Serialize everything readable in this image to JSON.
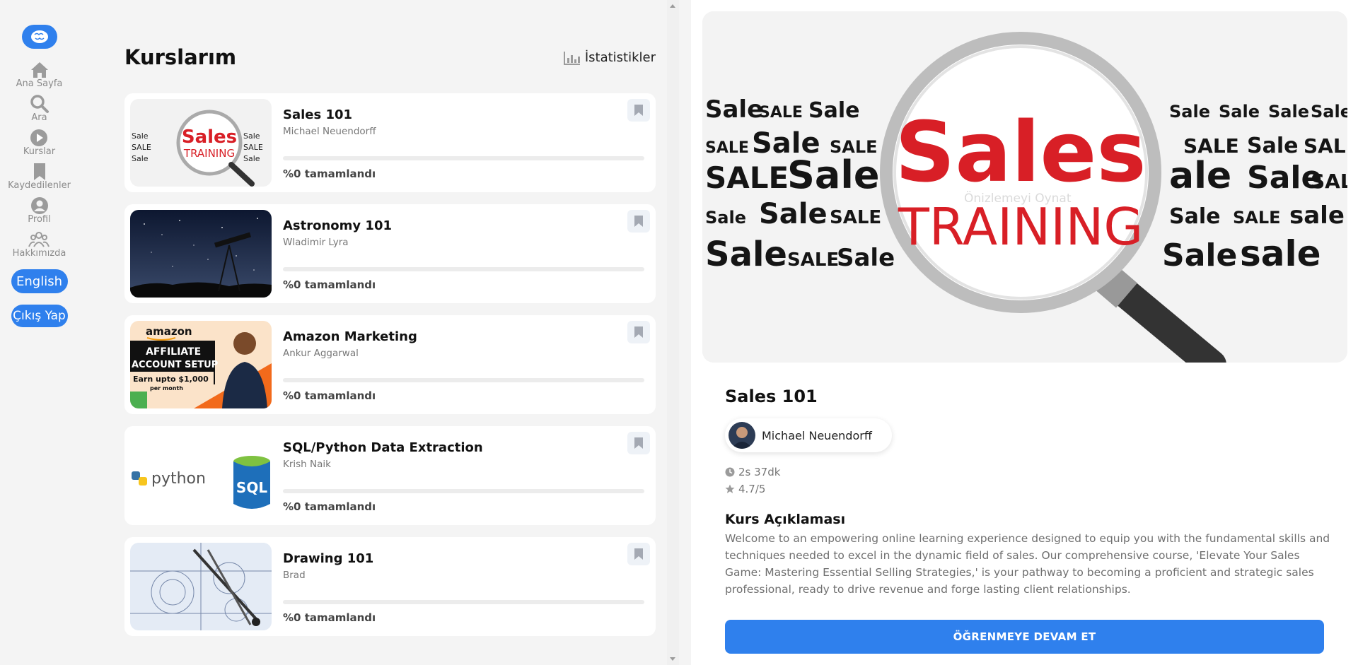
{
  "sidebar": {
    "items": [
      {
        "label": "Ana Sayfa",
        "icon": "home-icon"
      },
      {
        "label": "Ara",
        "icon": "search-icon"
      },
      {
        "label": "Kurslar",
        "icon": "play-icon"
      },
      {
        "label": "Kaydedilenler",
        "icon": "bookmark-icon"
      },
      {
        "label": "Profil",
        "icon": "user-icon"
      },
      {
        "label": "Hakkımızda",
        "icon": "group-icon"
      }
    ],
    "language_label": "English",
    "logout_label": "Çıkış Yap"
  },
  "list": {
    "title": "Kurslarım",
    "stats_label": "İstatistikler",
    "courses": [
      {
        "title": "Sales 101",
        "author": "Michael Neuendorff",
        "progress_text": "%0 tamamlandı",
        "progress": 0
      },
      {
        "title": "Astronomy 101",
        "author": "Wladimir Lyra",
        "progress_text": "%0 tamamlandı",
        "progress": 0
      },
      {
        "title": "Amazon Marketing",
        "author": "Ankur Aggarwal",
        "progress_text": "%0 tamamlandı",
        "progress": 0
      },
      {
        "title": "SQL/Python Data Extraction",
        "author": "Krish Naik",
        "progress_text": "%0 tamamlandı",
        "progress": 0
      },
      {
        "title": "Drawing 101",
        "author": "Brad",
        "progress_text": "%0 tamamlandı",
        "progress": 0
      }
    ],
    "thumb_text": {
      "sales_word": "Sales",
      "training_word": "TRAINING",
      "amazon_brand": "amazon",
      "amazon_line1": "AFFILIATE",
      "amazon_line2": "ACCOUNT SETUP",
      "amazon_line3": "Earn upto $1,000",
      "amazon_line4": "per month",
      "python_word": "python",
      "sql_word": "SQL"
    }
  },
  "detail": {
    "hero_main": "Sales",
    "hero_sub": "TRAINING",
    "hero_caption": "Önizlemeyi Oynat",
    "title": "Sales 101",
    "author": "Michael Neuendorff",
    "duration": "2s 37dk",
    "rating": "4.7/5",
    "description_title": "Kurs Açıklaması",
    "description": "Welcome to an empowering online learning experience designed to equip you with the fundamental skills and techniques needed to excel in the dynamic field of sales. Our comprehensive course, 'Elevate Your Sales Game: Mastering Essential Selling Strategies,' is your pathway to becoming a proficient and strategic sales professional, ready to drive revenue and forge lasting client relationships.",
    "cta_label": "ÖĞRENMEYE DEVAM ET"
  },
  "colors": {
    "accent": "#2f80ed",
    "sales_red": "#d81f26"
  }
}
